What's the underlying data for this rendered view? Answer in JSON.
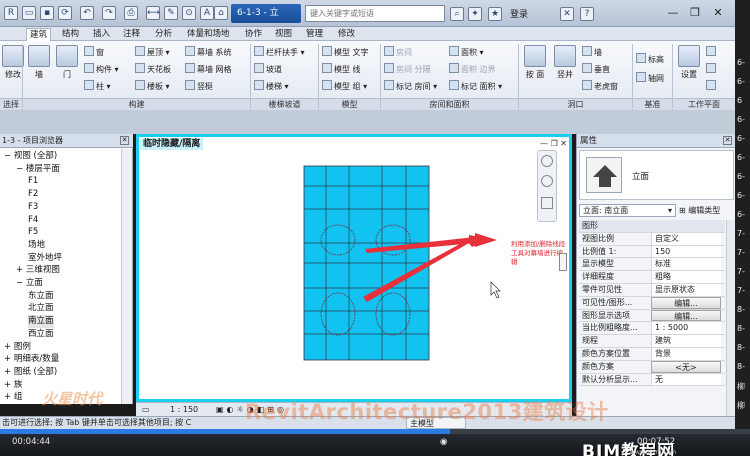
{
  "titlebar": {
    "doc_title": "6-1-3 - 立",
    "search_placeholder": "键入关键字或短语",
    "login": "登录"
  },
  "ribbon_tabs": [
    "建筑",
    "结构",
    "插入",
    "注释",
    "分析",
    "体量和场地",
    "协作",
    "视图",
    "管理",
    "修改"
  ],
  "ribbon": {
    "modify": "修改",
    "wall": "墙",
    "door": "门",
    "window": "窗",
    "component": "构件",
    "column": "柱",
    "roof": "屋顶",
    "ceiling": "天花板",
    "floor": "楼板",
    "curtain_system": "幕墙 系统",
    "curtain_grid": "幕墙 网格",
    "mullion": "竖梃",
    "railing": "栏杆扶手",
    "ramp": "坡道",
    "stair": "楼梯",
    "model_text": "模型 文字",
    "model_line": "模型 线",
    "model_group": "模型 组",
    "room": "房间",
    "room_sep": "房间 分隔",
    "tag_room": "标记 房间",
    "area": "面积",
    "area_boundary": "面积 边界",
    "tag_area": "标记 面积",
    "by_face": "按 面",
    "shaft": "竖井",
    "wall_opening": "墙",
    "vertical": "垂直",
    "dormer": "老虎窗",
    "level": "标高",
    "grid": "轴网",
    "set": "设置",
    "groups": {
      "select": "选择",
      "build": "构建",
      "circulation": "楼梯坡道",
      "model": "模型",
      "room_area": "房间和面积",
      "opening": "洞口",
      "datum": "基准",
      "work_plane": "工作平面"
    }
  },
  "browser": {
    "title": "1-3 - 项目浏览器",
    "items": [
      {
        "label": "视图 (全部)",
        "depth": 0,
        "toggle": "−"
      },
      {
        "label": "楼层平面",
        "depth": 1,
        "toggle": "−"
      },
      {
        "label": "F1",
        "depth": 2
      },
      {
        "label": "F2",
        "depth": 2
      },
      {
        "label": "F3",
        "depth": 2
      },
      {
        "label": "F4",
        "depth": 2
      },
      {
        "label": "F5",
        "depth": 2
      },
      {
        "label": "场地",
        "depth": 2
      },
      {
        "label": "室外地坪",
        "depth": 2
      },
      {
        "label": "三维视图",
        "depth": 1,
        "toggle": "+"
      },
      {
        "label": "立面",
        "depth": 1,
        "toggle": "−"
      },
      {
        "label": "东立面",
        "depth": 2
      },
      {
        "label": "北立面",
        "depth": 2
      },
      {
        "label": "南立面",
        "depth": 2,
        "selected": true
      },
      {
        "label": "西立面",
        "depth": 2
      },
      {
        "label": "图例",
        "depth": 0,
        "toggle": "+"
      },
      {
        "label": "明细表/数量",
        "depth": 0,
        "toggle": "+"
      },
      {
        "label": "图纸 (全部)",
        "depth": 0,
        "toggle": "+"
      },
      {
        "label": "族",
        "depth": 0,
        "toggle": "+"
      },
      {
        "label": "组",
        "depth": 0,
        "toggle": "+"
      }
    ]
  },
  "view": {
    "title": "临时隐藏/隔离",
    "note": "利用添加/删除线段工具对幕墙进行编辑",
    "scale": "1 : 150",
    "colors": {
      "curtain": "#12c3f2",
      "arrow": "#e8303a",
      "border": "#1ad0ee"
    }
  },
  "properties": {
    "title": "属性",
    "type_name": "立面",
    "instance": "立面: 南立面",
    "edit_type": "编辑类型",
    "rows": [
      {
        "k": "图形",
        "cat": true
      },
      {
        "k": "视图比例",
        "v": "自定义"
      },
      {
        "k": "比例值 1:",
        "v": "150"
      },
      {
        "k": "显示模型",
        "v": "标准"
      },
      {
        "k": "详细程度",
        "v": "粗略"
      },
      {
        "k": "零件可见性",
        "v": "显示原状态"
      },
      {
        "k": "可见性/图形...",
        "v": "编辑...",
        "btn": true
      },
      {
        "k": "图形显示选项",
        "v": "编辑...",
        "btn": true
      },
      {
        "k": "当比例粗略度...",
        "v": "1 : 5000"
      },
      {
        "k": "规程",
        "v": "建筑"
      },
      {
        "k": "颜色方案位置",
        "v": "背景"
      },
      {
        "k": "颜色方案",
        "v": "<无>",
        "btn": true
      },
      {
        "k": "默认分析显示...",
        "v": "无"
      }
    ]
  },
  "status": {
    "text": "击可进行选择; 按 Tab 键并单击可选择其他项目; 按 C",
    "model": "主模型"
  },
  "player": {
    "current": "00:04:44",
    "total": "00:07:52",
    "progress": 0.6
  },
  "watermark": {
    "text": "RevitArchitecture2013建筑设计",
    "brand": "火星时代",
    "logo": "BIM教程网",
    "url": "www.itbim.com"
  },
  "right_strip": [
    "6-",
    "6-",
    "6",
    "6-",
    "6-",
    "6-",
    "6-",
    "6-",
    "6-",
    "7-",
    "7-",
    "7-",
    "7-",
    "8-",
    "8-",
    "8-",
    "8-",
    "柳",
    "柳"
  ]
}
